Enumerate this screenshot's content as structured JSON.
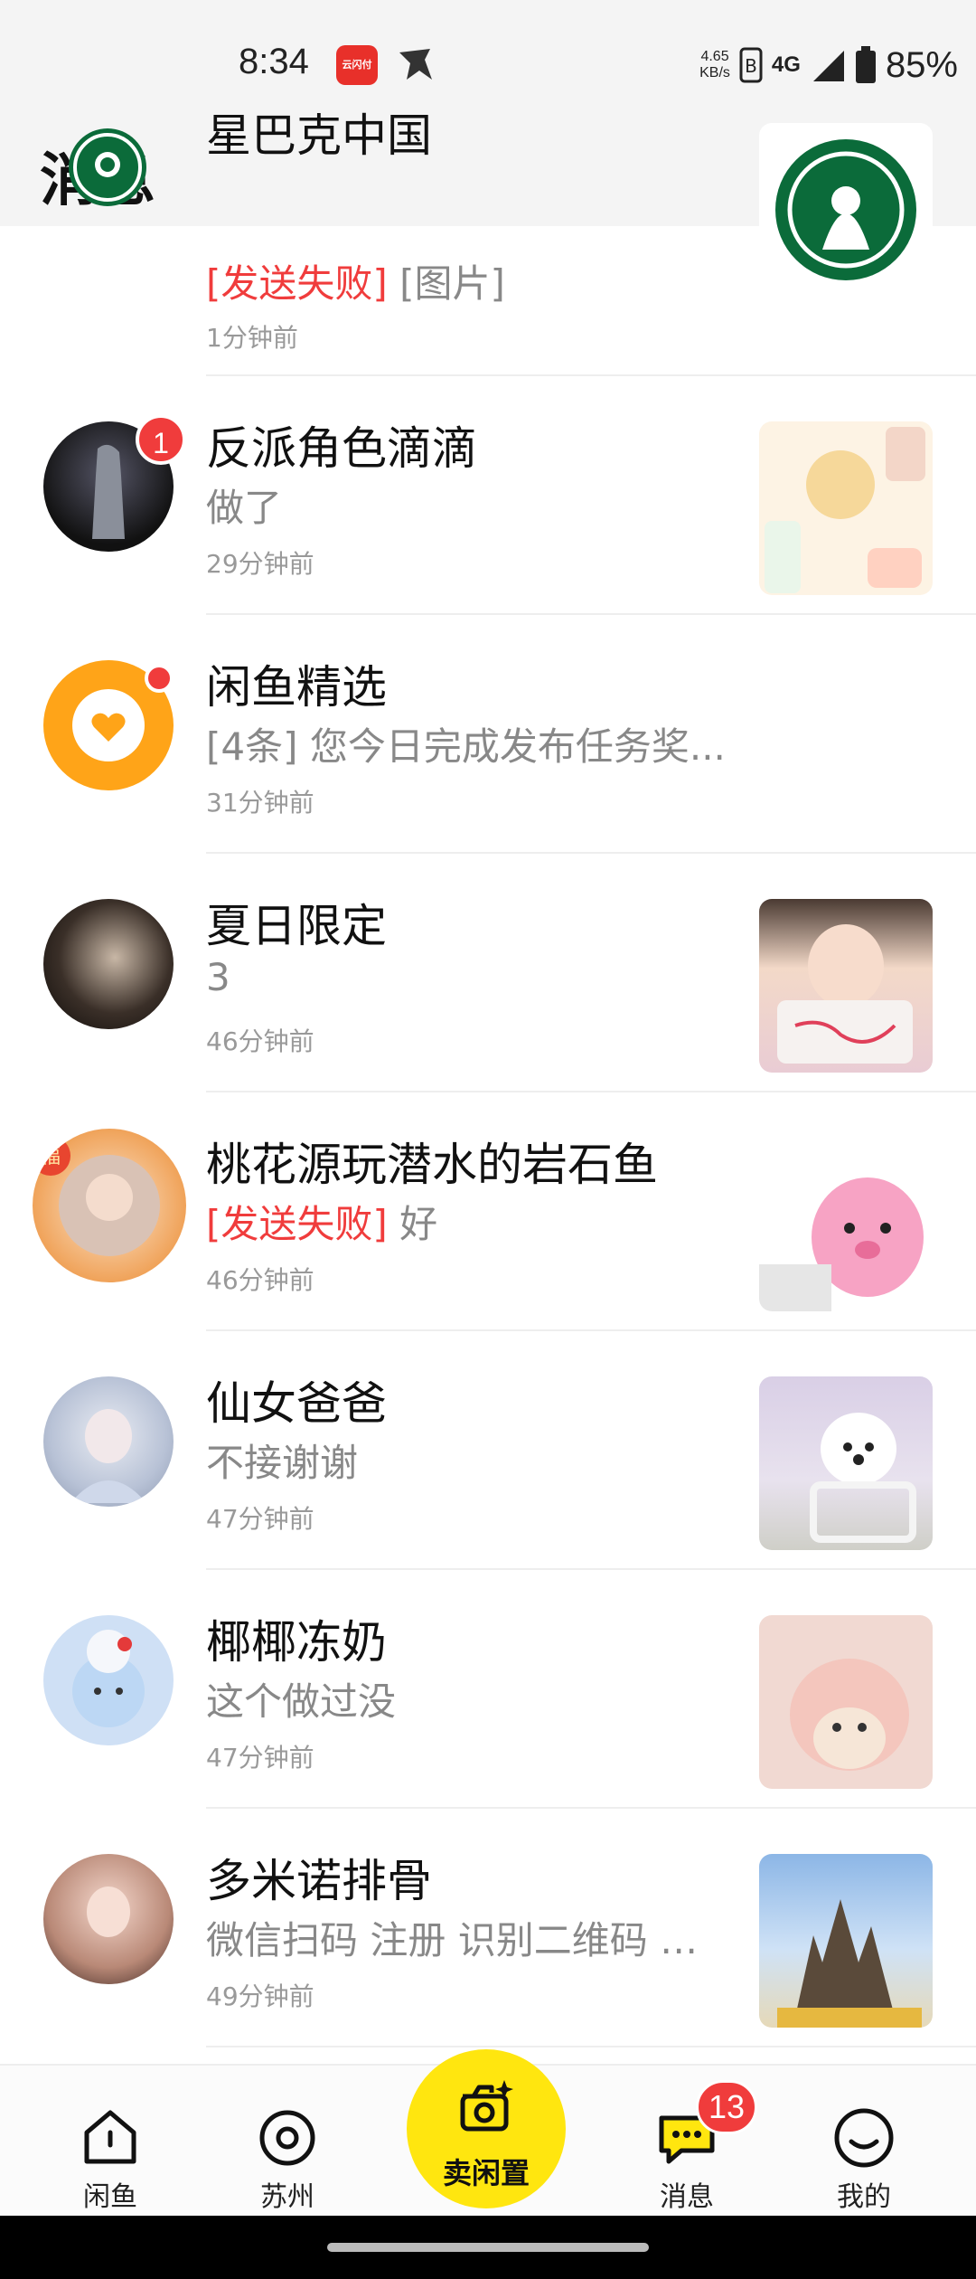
{
  "status_bar": {
    "time": "8:34",
    "app1_label": "云闪付",
    "net_speed_value": "4.65",
    "net_speed_unit": "KB/s",
    "network": "4G",
    "battery": "85%"
  },
  "header": {
    "title": "消息"
  },
  "conversations": [
    {
      "name": "星巴克中国",
      "fail_tag": "[发送失败]",
      "preview": " [图片]",
      "time": "1分钟前"
    },
    {
      "name": "反派角色滴滴",
      "fail_tag": "",
      "preview": "做了",
      "time": "29分钟前",
      "badge": "1"
    },
    {
      "name": "闲鱼精选",
      "fail_tag": "",
      "preview": "[4条] 您今日完成发布任务奖...",
      "time": "31分钟前"
    },
    {
      "name": "夏日限定",
      "fail_tag": "",
      "preview": "3",
      "time": "46分钟前"
    },
    {
      "name": "桃花源玩潜水的岩石鱼",
      "fail_tag": "[发送失败]",
      "preview": " 好",
      "time": "46分钟前"
    },
    {
      "name": "仙女爸爸",
      "fail_tag": "",
      "preview": "不接谢谢",
      "time": "47分钟前"
    },
    {
      "name": "椰椰冻奶",
      "fail_tag": "",
      "preview": "这个做过没",
      "time": "47分钟前"
    },
    {
      "name": "多米诺排骨",
      "fail_tag": "",
      "preview": "微信扫码 注册 识别二维码 添...",
      "time": "49分钟前"
    }
  ],
  "bottom_nav": {
    "home": "闲鱼",
    "city": "苏州",
    "sell": "卖闲置",
    "messages": "消息",
    "messages_badge": "13",
    "mine": "我的"
  },
  "colors": {
    "accent": "#ffe60f",
    "badge": "#f03c3c",
    "fail_text": "#f03c3c"
  }
}
